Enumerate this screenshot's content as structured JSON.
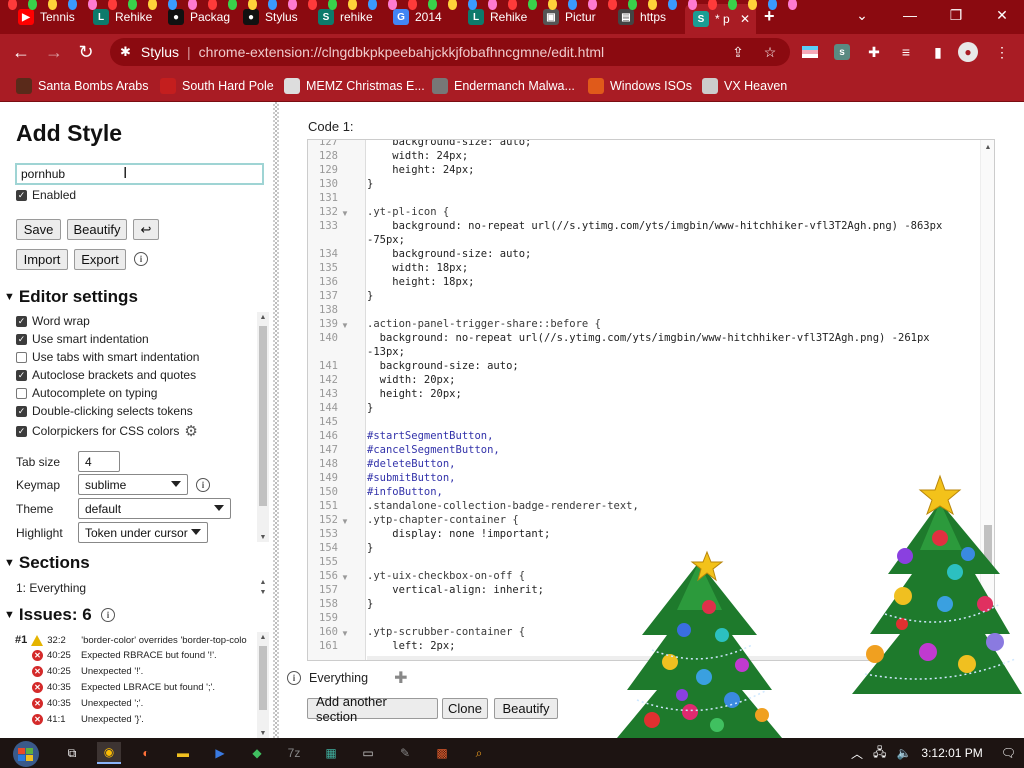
{
  "browser": {
    "tabs": [
      {
        "label": "Tennis",
        "icon": "youtube-icon",
        "color": "#ff0000",
        "glyph": "▶"
      },
      {
        "label": "Rehike",
        "icon": "rehike-icon",
        "color": "#0d7a6b",
        "glyph": "L"
      },
      {
        "label": "Packag",
        "icon": "github-icon",
        "color": "#111111",
        "glyph": "●"
      },
      {
        "label": "Stylus",
        "icon": "github-icon",
        "color": "#111111",
        "glyph": "●"
      },
      {
        "label": "rehike",
        "icon": "stylus-icon",
        "color": "#0d7a6b",
        "glyph": "S"
      },
      {
        "label": "2014",
        "icon": "google-icon",
        "color": "#4285f4",
        "glyph": "G"
      },
      {
        "label": "Rehike",
        "icon": "rehike-icon",
        "color": "#0d7a6b",
        "glyph": "L"
      },
      {
        "label": "Pictur",
        "icon": "image-icon",
        "color": "#555555",
        "glyph": "▣"
      },
      {
        "label": "https",
        "icon": "page-icon",
        "color": "#444444",
        "glyph": "▤"
      },
      {
        "label": "* p",
        "icon": "stylus-icon",
        "color": "#1a9e94",
        "glyph": "S"
      }
    ],
    "address": {
      "origin": "Stylus",
      "path": "chrome-extension://clngdbkpkpeebahjckkjfobafhncgmne/edit.html"
    },
    "bookmarks": [
      {
        "label": "Santa Bombs Arabs",
        "icon": "bookmark-icon",
        "color": "#5a2a1a"
      },
      {
        "label": "South Hard Pole",
        "icon": "bookmark-icon",
        "color": "#c41e1e"
      },
      {
        "label": "MEMZ Christmas E...",
        "icon": "bookmark-icon",
        "color": "#dddddd"
      },
      {
        "label": "Endermanch Malwa...",
        "icon": "bookmark-icon",
        "color": "#777777"
      },
      {
        "label": "Windows ISOs",
        "icon": "windows-icon",
        "color": "#e05a1a"
      },
      {
        "label": "VX Heaven",
        "icon": "bookmark-icon",
        "color": "#cccccc"
      }
    ],
    "accent_color": "#a91c24",
    "tabbar_color": "#8b0a10"
  },
  "sidebar": {
    "title": "Add Style",
    "name_input_value": "pornhub",
    "enabled_label": "Enabled",
    "buttons": {
      "save": "Save",
      "beautify": "Beautify",
      "undo": "↩",
      "import": "Import",
      "export": "Export"
    },
    "editor_settings": {
      "heading": "Editor settings",
      "options": [
        {
          "label": "Word wrap",
          "checked": true
        },
        {
          "label": "Use smart indentation",
          "checked": true
        },
        {
          "label": "Use tabs with smart indentation",
          "checked": false
        },
        {
          "label": "Autoclose brackets and quotes",
          "checked": true
        },
        {
          "label": "Autocomplete on typing",
          "checked": false
        },
        {
          "label": "Double-clicking selects tokens",
          "checked": true
        },
        {
          "label": "Colorpickers for CSS colors",
          "checked": true
        }
      ],
      "tab_size_label": "Tab size",
      "tab_size_value": "4",
      "keymap_label": "Keymap",
      "keymap_value": "sublime",
      "theme_label": "Theme",
      "theme_value": "default",
      "highlight_label": "Highlight",
      "highlight_value": "Token under cursor"
    },
    "sections": {
      "heading": "Sections",
      "items": [
        "1: Everything"
      ]
    },
    "issues": {
      "heading": "Issues: 6",
      "first_index": "#1",
      "items": [
        {
          "type": "warning",
          "loc": "32:2",
          "text": "'border-color' overrides 'border-top-colo"
        },
        {
          "type": "error",
          "loc": "40:25",
          "text": "Expected RBRACE but found '!'."
        },
        {
          "type": "error",
          "loc": "40:25",
          "text": "Unexpected '!'."
        },
        {
          "type": "error",
          "loc": "40:35",
          "text": "Expected LBRACE but found ';'."
        },
        {
          "type": "error",
          "loc": "40:35",
          "text": "Unexpected ';'."
        },
        {
          "type": "error",
          "loc": "41:1",
          "text": "Unexpected '}'."
        }
      ]
    }
  },
  "editor": {
    "code_label": "Code 1:",
    "lines": [
      {
        "n": "127",
        "text": "    background-size: auto;",
        "fold": false
      },
      {
        "n": "128",
        "text": "    width: 24px;",
        "fold": false
      },
      {
        "n": "129",
        "text": "    height: 24px;",
        "fold": false
      },
      {
        "n": "130",
        "text": "}",
        "fold": false
      },
      {
        "n": "131",
        "text": "",
        "fold": false
      },
      {
        "n": "132",
        "text": ".yt-pl-icon {",
        "fold": true
      },
      {
        "n": "133",
        "text": "    background: no-repeat url(//s.ytimg.com/yts/imgbin/www-hitchhiker-vfl3T2Agh.png) -863px",
        "fold": false
      },
      {
        "n": "",
        "text": "-75px;",
        "fold": false
      },
      {
        "n": "134",
        "text": "    background-size: auto;",
        "fold": false
      },
      {
        "n": "135",
        "text": "    width: 18px;",
        "fold": false
      },
      {
        "n": "136",
        "text": "    height: 18px;",
        "fold": false
      },
      {
        "n": "137",
        "text": "}",
        "fold": false
      },
      {
        "n": "138",
        "text": "",
        "fold": false
      },
      {
        "n": "139",
        "text": ".action-panel-trigger-share::before {",
        "fold": true
      },
      {
        "n": "140",
        "text": "  background: no-repeat url(//s.ytimg.com/yts/imgbin/www-hitchhiker-vfl3T2Agh.png) -261px",
        "fold": false
      },
      {
        "n": "",
        "text": "-13px;",
        "fold": false
      },
      {
        "n": "141",
        "text": "  background-size: auto;",
        "fold": false
      },
      {
        "n": "142",
        "text": "  width: 20px;",
        "fold": false
      },
      {
        "n": "143",
        "text": "  height: 20px;",
        "fold": false
      },
      {
        "n": "144",
        "text": "}",
        "fold": false
      },
      {
        "n": "145",
        "text": "",
        "fold": false
      },
      {
        "n": "146",
        "text": "#startSegmentButton,",
        "fold": false
      },
      {
        "n": "147",
        "text": "#cancelSegmentButton,",
        "fold": false
      },
      {
        "n": "148",
        "text": "#deleteButton,",
        "fold": false
      },
      {
        "n": "149",
        "text": "#submitButton,",
        "fold": false
      },
      {
        "n": "150",
        "text": "#infoButton,",
        "fold": false
      },
      {
        "n": "151",
        "text": ".standalone-collection-badge-renderer-text,",
        "fold": false
      },
      {
        "n": "152",
        "text": ".ytp-chapter-container {",
        "fold": true
      },
      {
        "n": "153",
        "text": "    display: none !important;",
        "fold": false
      },
      {
        "n": "154",
        "text": "}",
        "fold": false
      },
      {
        "n": "155",
        "text": "",
        "fold": false
      },
      {
        "n": "156",
        "text": ".yt-uix-checkbox-on-off {",
        "fold": true
      },
      {
        "n": "157",
        "text": "    vertical-align: inherit;",
        "fold": false
      },
      {
        "n": "158",
        "text": "}",
        "fold": false
      },
      {
        "n": "159",
        "text": "",
        "fold": false
      },
      {
        "n": "160",
        "text": ".ytp-scrubber-container {",
        "fold": true
      },
      {
        "n": "161",
        "text": "    left: 2px;",
        "fold": false
      }
    ],
    "section_name": "Everything",
    "bottom_buttons": {
      "add": "Add another section",
      "clone": "Clone",
      "beautify": "Beautify"
    }
  },
  "taskbar": {
    "time": "3:12:01 PM",
    "apps": [
      {
        "icon": "task-view-icon"
      },
      {
        "icon": "chrome-icon"
      },
      {
        "icon": "firefox-icon"
      },
      {
        "icon": "folder-icon"
      },
      {
        "icon": "powershell-icon"
      },
      {
        "icon": "app-icon"
      },
      {
        "icon": "7zip-icon"
      },
      {
        "icon": "notepad-icon"
      },
      {
        "icon": "terminal-icon"
      },
      {
        "icon": "app-icon"
      },
      {
        "icon": "app-icon"
      },
      {
        "icon": "search-app-icon"
      }
    ]
  }
}
